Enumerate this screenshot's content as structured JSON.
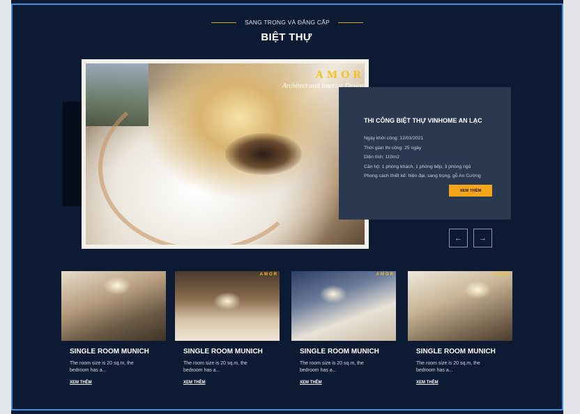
{
  "section": {
    "eyebrow": "SANG TRỌNG VÀ ĐẲNG CẤP",
    "title": "BIỆT THỰ"
  },
  "colors": {
    "background": "#0c1a33",
    "accent": "#f5a51a",
    "card": "#2b3950",
    "brand": "#f2c21c",
    "selection_border": "#3a8fd8"
  },
  "hero": {
    "brand": "AMOR",
    "brand_sub": "Architect and Interior Design"
  },
  "project": {
    "title": "THI CÔNG BIỆT THỰ VINHOME AN LẠC",
    "details": [
      "Ngày khởi công: 12/03/2021",
      "Thời gian thi công: 25 ngày",
      "Diện tích: 110m2",
      "Căn hộ: 1 phòng khách, 1 phòng bếp, 3 phòng ngủ",
      "Phong cách thiết kế: hiện đại, sang trọng, gỗ An Cường"
    ],
    "cta_label": "XEM THÊM"
  },
  "slider": {
    "prev_icon": "arrow-left-icon",
    "next_icon": "arrow-right-icon",
    "prev_glyph": "←",
    "next_glyph": "→"
  },
  "rooms": [
    {
      "name": "SINGLE ROOM MUNICH",
      "desc": "The room size is 20 sq.m, the bedroom has a...",
      "more": "XEM THÊM",
      "brand": ""
    },
    {
      "name": "SINGLE ROOM MUNICH",
      "desc": "The room size is 20 sq.m, the bedroom has a...",
      "more": "XEM THÊM",
      "brand": "AMOR"
    },
    {
      "name": "SINGLE ROOM MUNICH",
      "desc": "The room size is 20 sq.m, the bedroom has a...",
      "more": "XEM THÊM",
      "brand": "AMOR"
    },
    {
      "name": "SINGLE ROOM MUNICH",
      "desc": "The room size is 20 sq.m, the bedroom has a...",
      "more": "XEM THÊM",
      "brand": "AMOR"
    }
  ]
}
